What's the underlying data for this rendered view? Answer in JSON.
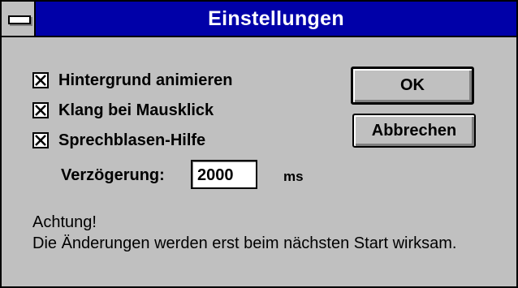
{
  "window": {
    "title": "Einstellungen"
  },
  "checkboxes": [
    {
      "label": "Hintergrund animieren",
      "checked": true
    },
    {
      "label": "Klang bei Mausklick",
      "checked": true
    },
    {
      "label": "Sprechblasen-Hilfe",
      "checked": true
    }
  ],
  "delay": {
    "label": "Verzögerung:",
    "value": "2000",
    "unit": "ms"
  },
  "buttons": {
    "ok_label": "OK",
    "cancel_label": "Abbrechen"
  },
  "note": {
    "heading": "Achtung!",
    "text": "Die Änderungen werden erst beim nächsten Start wirksam."
  },
  "colors": {
    "title_bar": "#0000a8",
    "face": "#c0c0c0"
  },
  "icons": {
    "system_menu": "system-menu-icon",
    "check": "check-x-icon"
  }
}
